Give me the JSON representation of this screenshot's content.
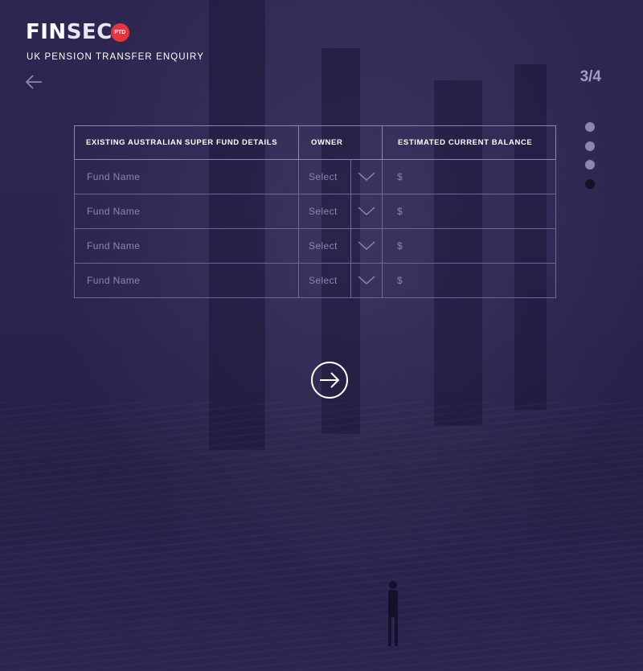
{
  "brand": {
    "logo_fin": "FIN",
    "logo_sec": "SEC",
    "logo_badge": "PTD",
    "subtitle": "UK PENSION TRANSFER ENQUIRY"
  },
  "navigation": {
    "back_icon": "arrow-left-icon",
    "next_icon": "arrow-right-circle-icon",
    "step_counter": "3/4",
    "progress": {
      "total_steps": 4,
      "current_step": 4
    }
  },
  "table": {
    "headers": {
      "fund": "EXISTING AUSTRALIAN SUPER FUND DETAILS",
      "owner": "OWNER",
      "balance": "ESTIMATED CURRENT BALANCE"
    },
    "rows": [
      {
        "fund_placeholder": "Fund Name",
        "owner_value": "Select",
        "balance_placeholder": "$"
      },
      {
        "fund_placeholder": "Fund Name",
        "owner_value": "Select",
        "balance_placeholder": "$"
      },
      {
        "fund_placeholder": "Fund Name",
        "owner_value": "Select",
        "balance_placeholder": "$"
      },
      {
        "fund_placeholder": "Fund Name",
        "owner_value": "Select",
        "balance_placeholder": "$"
      }
    ]
  },
  "colors": {
    "background": "#282248",
    "table_border": "#6c6898",
    "placeholder_text": "#8a86b3",
    "dot_inactive": "#8b86b5",
    "dot_active": "#14112a",
    "badge": "#e8343c"
  }
}
